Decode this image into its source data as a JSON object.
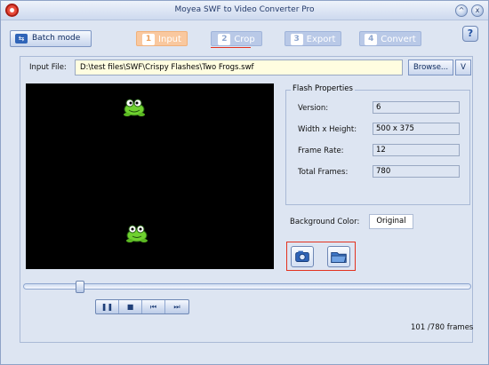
{
  "window": {
    "title": "Moyea SWF to Video Converter Pro",
    "minimize_label": "^",
    "close_label": "x"
  },
  "toolbar": {
    "batch_label": "Batch mode",
    "help_label": "?"
  },
  "steps": [
    {
      "number": "1",
      "label": "Input",
      "state": "active"
    },
    {
      "number": "2",
      "label": "Crop",
      "state": "next"
    },
    {
      "number": "3",
      "label": "Export",
      "state": "disabled"
    },
    {
      "number": "4",
      "label": "Convert",
      "state": "disabled"
    }
  ],
  "input": {
    "label": "Input File:",
    "value": "D:\\test files\\SWF\\Crispy Flashes\\Two Frogs.swf",
    "browse_label": "Browse...",
    "v_label": "V"
  },
  "flash_properties": {
    "title": "Flash Properties",
    "version_label": "Version:",
    "version_value": "6",
    "size_label": "Width x Height:",
    "size_value": "500 x 375",
    "rate_label": "Frame Rate:",
    "rate_value": "12",
    "frames_label": "Total Frames:",
    "frames_value": "780"
  },
  "background": {
    "label": "Background Color:",
    "value": "Original"
  },
  "playback": {
    "progress_fraction": 0.129,
    "frame_counter": "101 /780 frames"
  },
  "colors": {
    "window_bg": "#dde5f2",
    "highlight_red": "#e3321f",
    "active_step": "#f9c89f",
    "frog_green": "#6fd12f"
  },
  "icons": [
    "settings-icon",
    "batch-mode-icon",
    "snapshot-icon",
    "folder-icon",
    "pause-icon",
    "stop-icon",
    "previous-icon",
    "next-icon",
    "frog-sprite"
  ]
}
